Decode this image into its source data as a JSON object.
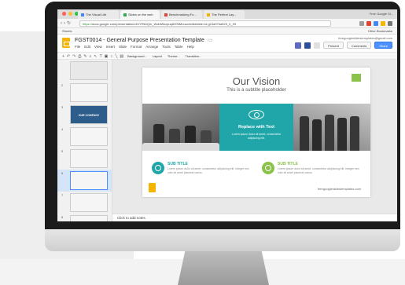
{
  "browser": {
    "tabs": [
      {
        "label": "The Visual Life",
        "favicon_color": "#4285f4"
      },
      {
        "label": "Slides on the web",
        "favicon_color": "#34a853"
      },
      {
        "label": "Benchmarking Fo...",
        "favicon_color": "#db4437"
      },
      {
        "label": "The Perfect Lay...",
        "favicon_color": "#f4b400"
      }
    ],
    "profile": "Free Google Sl...",
    "url_scheme": "https://",
    "url_rest": "docs.google.com/presentation/d/1YRkhQm_WobMfxzpuq8OStMnuux/edit#slide=id.g13a97ba523_0_93",
    "bookmarks_left": "Sheets",
    "bookmarks_right": "Other Bookmarks"
  },
  "app": {
    "title": "FGST0014 - General Purpose Presentation Template",
    "folder_icon": "folder-icon",
    "menu": [
      "File",
      "Edit",
      "View",
      "Insert",
      "Slide",
      "Format",
      "Arrange",
      "Tools",
      "Table",
      "Help"
    ],
    "email": "freegoogleslidestemplates@gmail.com",
    "present_label": "Present",
    "comments_label": "Comments",
    "share_label": "Share",
    "toolbar_buttons": [
      "Background...",
      "Layout",
      "Theme...",
      "Transition..."
    ],
    "brand_color": "#f4b400"
  },
  "filmstrip": {
    "slides": [
      {
        "num": "",
        "bg": "#e8e8e8",
        "label": ""
      },
      {
        "num": "2",
        "bg": "#f5f5f5",
        "label": ""
      },
      {
        "num": "3",
        "bg": "#2d5d8a",
        "label": "OUR COMPANY"
      },
      {
        "num": "4",
        "bg": "#f5f5f5",
        "label": ""
      },
      {
        "num": "5",
        "bg": "#f5f5f5",
        "label": ""
      },
      {
        "num": "6",
        "bg": "#f5f5f5",
        "label": ""
      },
      {
        "num": "7",
        "bg": "#f5f5f5",
        "label": ""
      },
      {
        "num": "8",
        "bg": "#f5f5f5",
        "label": ""
      }
    ],
    "selected_index": 5
  },
  "slide": {
    "title": "Our Vision",
    "subtitle": "This is a subtitle placeholder",
    "teal_title": "Replace with Text",
    "teal_text": "Lorem ipsum dolor sit amet, consectetur adipiscing elit.",
    "accent_color": "#20a6a8",
    "green_color": "#8bc34a",
    "sub_a": {
      "title": "SUB TITLE",
      "text": "Lorem ipsum dolor sit amet, consectetur adipiscing elit. Integer nec odio sit amet placerat varius.",
      "color": "#20a6a8"
    },
    "sub_b": {
      "title": "SUB TITLE",
      "text": "Lorem ipsum dolor sit amet, consectetur adipiscing elit. Integer nec odio sit amet placerat varius.",
      "color": "#8bc34a"
    },
    "footer": "freegoogleslidestemplates.com"
  },
  "notes": {
    "placeholder": "Click to add notes"
  }
}
